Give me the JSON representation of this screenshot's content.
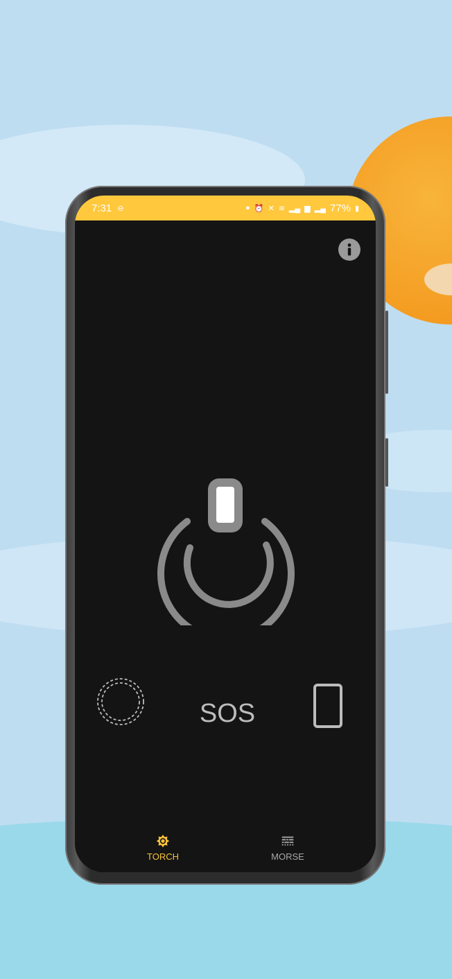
{
  "status_bar": {
    "time": "7:31",
    "battery": "77%",
    "icons": [
      "do-not-disturb-icon",
      "notification-icon",
      "alarm-icon",
      "mute-icon",
      "wifi-icon",
      "signal-icon",
      "volte-icon",
      "signal-icon",
      "battery-icon"
    ]
  },
  "main": {
    "power_state": "off",
    "sos_label": "SOS"
  },
  "bottom_nav": {
    "items": [
      {
        "label": "TORCH",
        "icon": "brightness-icon",
        "active": true
      },
      {
        "label": "MORSE",
        "icon": "morse-icon",
        "active": false
      }
    ]
  },
  "colors": {
    "accent": "#ffc83d",
    "screen_bg": "#141414",
    "icon_gray": "#8a8a8a"
  }
}
